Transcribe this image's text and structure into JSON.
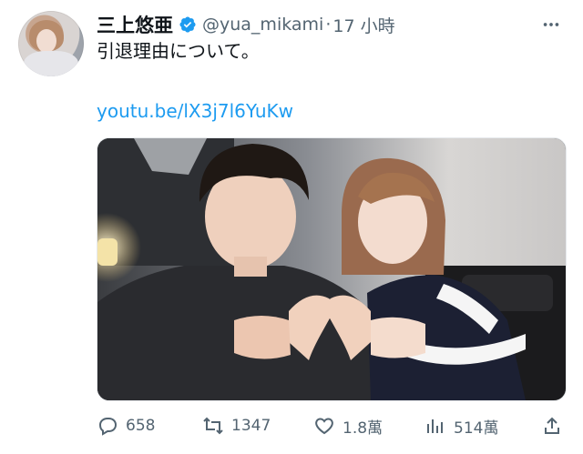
{
  "tweet": {
    "author": {
      "display_name": "三上悠亜",
      "handle": "@yua_mikami",
      "verified": true
    },
    "separator": "·",
    "time_ago": "17 小時",
    "text": "引退理由について。",
    "link": "youtu.be/lX3j7l6YuKw"
  },
  "actions": {
    "replies": "658",
    "retweets": "1347",
    "likes": "1.8萬",
    "views": "514萬"
  },
  "icons": [
    "verified-badge-icon",
    "more-icon",
    "reply-icon",
    "retweet-icon",
    "like-icon",
    "views-icon",
    "share-icon"
  ],
  "colors": {
    "text": "#0f1419",
    "secondary": "#536471",
    "link": "#1d9bf0"
  }
}
